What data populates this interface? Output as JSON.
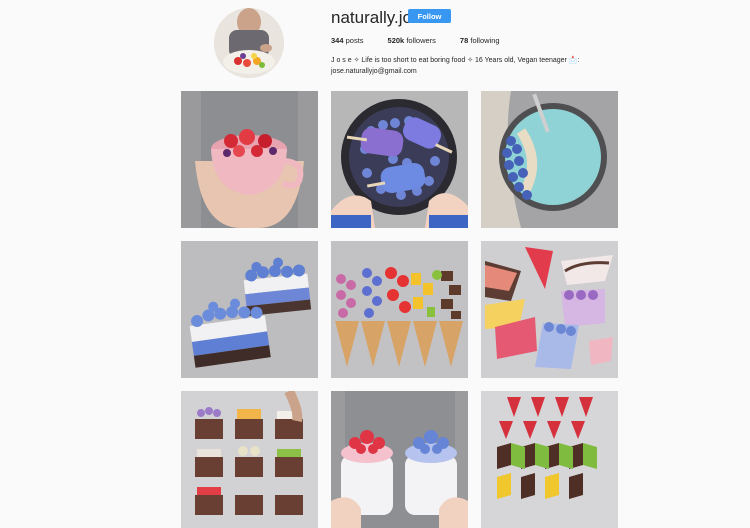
{
  "profile": {
    "username": "naturally.jo",
    "follow_label": "Follow",
    "stats": {
      "posts_count": "344",
      "posts_label": "posts",
      "followers_count": "520k",
      "followers_label": "followers",
      "following_count": "78",
      "following_label": "following"
    },
    "bio_line1": "J o s e ✧ Life is too short to eat boring food ✧ 16 Years old, Vegan teenager 📩:",
    "bio_email": "jose.naturallyjo@gmail.com"
  },
  "colors": {
    "accent": "#3897f0",
    "background": "#fafafa",
    "text": "#262626"
  },
  "posts": [
    {
      "subject": "strawberry-smoothie-mug"
    },
    {
      "subject": "blueberry-popsicle-bowl"
    },
    {
      "subject": "blue-smoothie-bowl"
    },
    {
      "subject": "blueberry-cheesecake-bars"
    },
    {
      "subject": "rainbow-fruit-cones"
    },
    {
      "subject": "raw-cake-slices"
    },
    {
      "subject": "brownie-squares"
    },
    {
      "subject": "strawberry-blueberry-mugs"
    },
    {
      "subject": "fruit-chocolate-rows"
    }
  ]
}
